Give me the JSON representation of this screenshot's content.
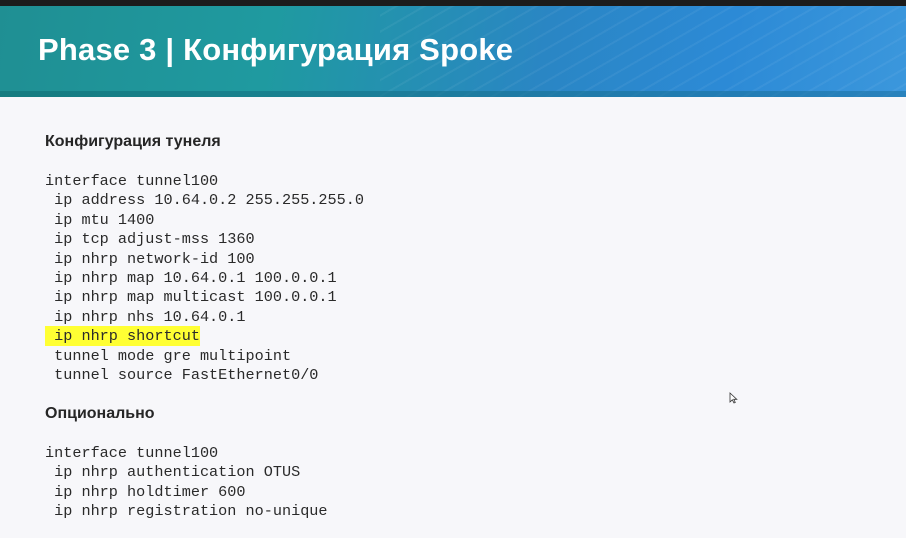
{
  "slide": {
    "title": "Phase 3 | Конфигурация Spoke",
    "sections": [
      {
        "heading": "Конфигурация тунеля",
        "lines": [
          {
            "text": "interface tunnel100",
            "highlight": false
          },
          {
            "text": " ip address 10.64.0.2 255.255.255.0",
            "highlight": false
          },
          {
            "text": " ip mtu 1400",
            "highlight": false
          },
          {
            "text": " ip tcp adjust-mss 1360",
            "highlight": false
          },
          {
            "text": " ip nhrp network-id 100",
            "highlight": false
          },
          {
            "text": " ip nhrp map 10.64.0.1 100.0.0.1",
            "highlight": false
          },
          {
            "text": " ip nhrp map multicast 100.0.0.1",
            "highlight": false
          },
          {
            "text": " ip nhrp nhs 10.64.0.1",
            "highlight": false
          },
          {
            "text": " ip nhrp shortcut",
            "highlight": true
          },
          {
            "text": " tunnel mode gre multipoint",
            "highlight": false
          },
          {
            "text": " tunnel source FastEthernet0/0",
            "highlight": false
          }
        ]
      },
      {
        "heading": "Опционально",
        "lines": [
          {
            "text": "interface tunnel100",
            "highlight": false
          },
          {
            "text": " ip nhrp authentication OTUS",
            "highlight": false
          },
          {
            "text": " ip nhrp holdtimer 600",
            "highlight": false
          },
          {
            "text": " ip nhrp registration no-unique",
            "highlight": false
          }
        ]
      }
    ],
    "highlight_color": "#ffff33",
    "banner_colors": [
      "#1f8f93",
      "#2c8ad6"
    ]
  }
}
